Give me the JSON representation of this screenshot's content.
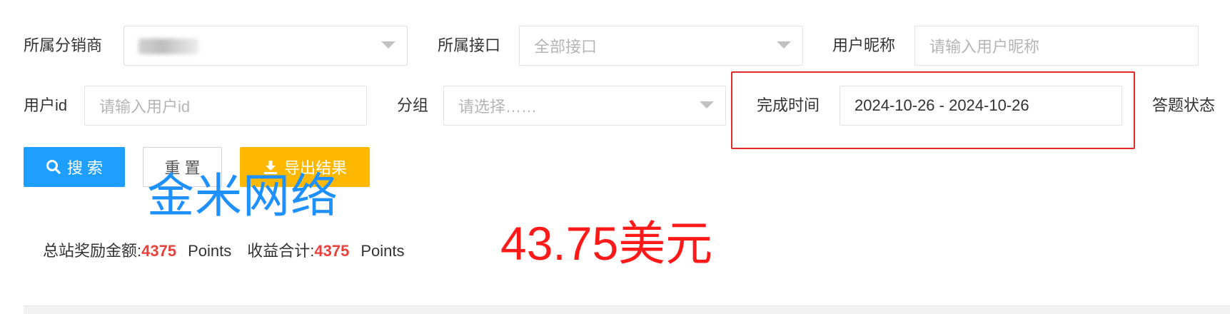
{
  "filters": {
    "distributor": {
      "label": "所属分销商"
    },
    "api": {
      "label": "所属接口",
      "value": "全部接口"
    },
    "nickname": {
      "label": "用户昵称",
      "placeholder": "请输入用户昵称"
    },
    "user_id": {
      "label": "用户id",
      "placeholder": "请输入用户id"
    },
    "group": {
      "label": "分组",
      "placeholder": "请选择……"
    },
    "finish_time": {
      "label": "完成时间",
      "value": "2024-10-26 - 2024-10-26"
    },
    "answer_status": {
      "label": "答题状态"
    }
  },
  "buttons": {
    "search": "搜 索",
    "reset": "重 置",
    "export": "导出结果"
  },
  "watermark": "金米网络",
  "stats": {
    "total_reward_label": "总站奖励金额:",
    "total_reward_value": "4375",
    "total_reward_unit": "Points",
    "income_label": "收益合计:",
    "income_value": "4375",
    "income_unit": "Points"
  },
  "annotation": "43.75美元",
  "colors": {
    "primary": "#1e9fff",
    "warning": "#ffb800",
    "highlight_border": "#e02b2b",
    "stat_number": "#e8413c",
    "watermark": "#1e90ff"
  }
}
